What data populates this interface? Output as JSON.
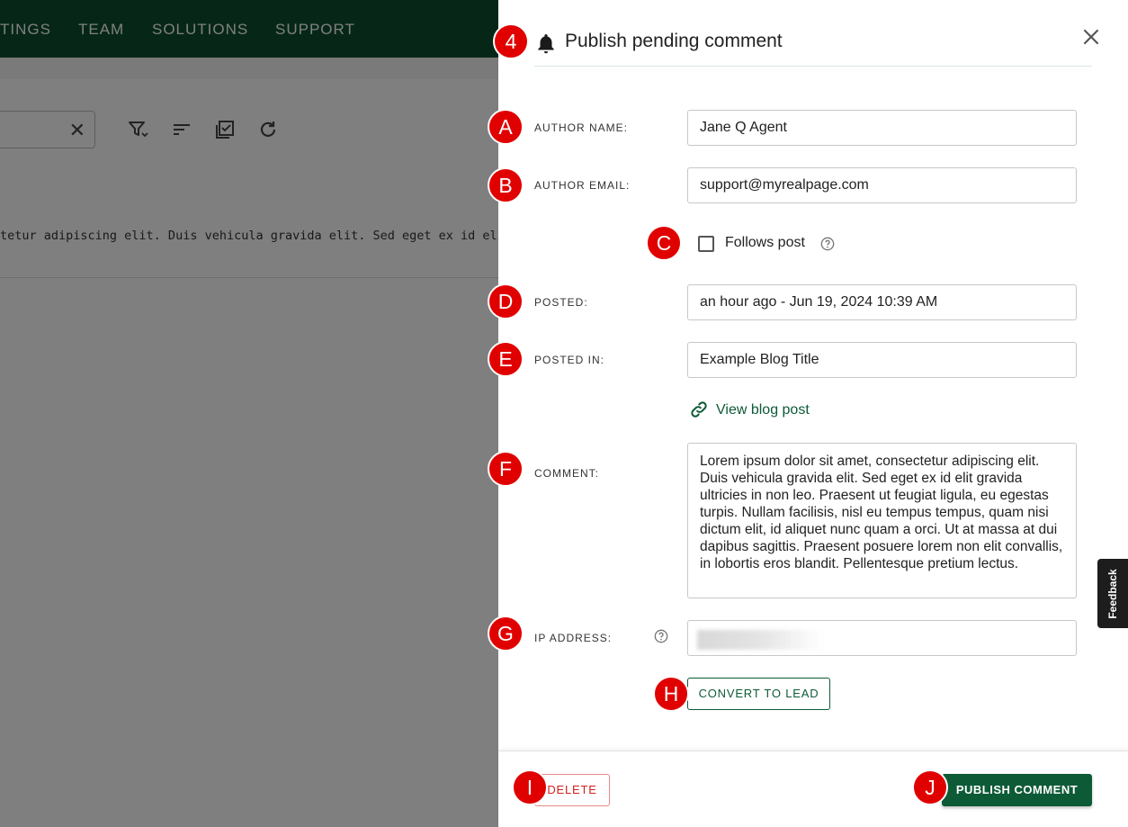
{
  "nav": {
    "items": [
      "TINGS",
      "TEAM",
      "SOLUTIONS",
      "SUPPORT"
    ]
  },
  "background": {
    "search_clear": "✕",
    "text_line": "tetur adipiscing elit. Duis vehicula gravida elit. Sed eget ex id eli"
  },
  "drawer": {
    "title": "Publish pending comment",
    "fields": {
      "author_name_label": "AUTHOR NAME:",
      "author_name_value": "Jane Q Agent",
      "author_email_label": "AUTHOR EMAIL:",
      "author_email_value": "support@myrealpage.com",
      "follows_post_label": "Follows post",
      "posted_label": "POSTED:",
      "posted_value": "an hour ago - Jun 19, 2024 10:39 AM",
      "posted_in_label": "POSTED IN:",
      "posted_in_value": "Example Blog Title",
      "view_blog_post": "View blog post",
      "comment_label": "COMMENT:",
      "comment_value": "Lorem ipsum dolor sit amet, consectetur adipiscing elit. Duis vehicula gravida elit. Sed eget ex id elit gravida ultricies in non leo. Praesent ut feugiat ligula, eu egestas turpis. Nullam facilisis, nisl eu tempus tempus, quam nisi dictum elit, id aliquet nunc quam a orci. Ut at massa at dui dapibus sagittis. Praesent posuere lorem non elit convallis, in lobortis eros blandit. Pellentesque pretium lectus.",
      "ip_address_label": "IP ADDRESS:"
    },
    "buttons": {
      "convert_to_lead": "CONVERT TO LEAD",
      "delete": "DELETE",
      "publish_comment": "PUBLISH COMMENT"
    }
  },
  "feedback": {
    "label": "Feedback"
  },
  "markers": [
    "4",
    "A",
    "B",
    "C",
    "D",
    "E",
    "F",
    "G",
    "H",
    "I",
    "J"
  ],
  "colors": {
    "brand_green": "#0d5a36",
    "nav_green": "#0d4f2f",
    "delete_red": "#d42020",
    "marker_red": "#e00000"
  }
}
